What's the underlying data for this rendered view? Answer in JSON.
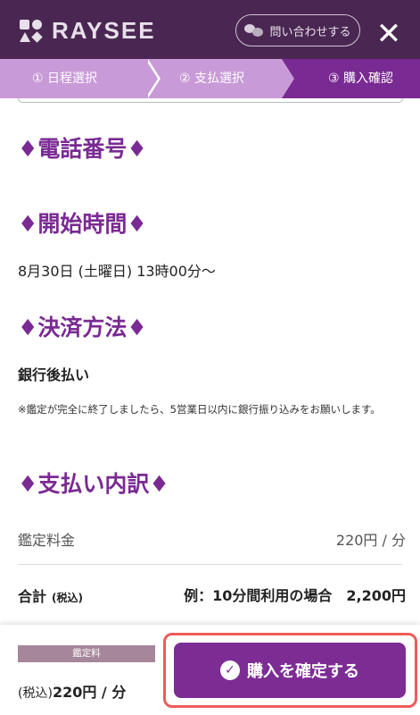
{
  "header": {
    "logo_text": "RAYSEE",
    "contact_label": "問い合わせする",
    "close_glyph": "✕"
  },
  "steps": [
    {
      "label": "① 日程選択"
    },
    {
      "label": "② 支払選択"
    },
    {
      "label": "③ 購入確認"
    }
  ],
  "sections": {
    "phone_title": "♦電話番号♦",
    "time_title": "♦開始時間♦",
    "datetime": "8月30日 (土曜日) 13時00分〜",
    "payment_title": "♦決済方法♦",
    "payment_method": "銀行後払い",
    "payment_note": "※鑑定が完全に終了しましたら、5営業日以内に銀行振り込みをお願いします。",
    "breakdown_title": "♦支払い内訳♦"
  },
  "breakdown": {
    "fee_label": "鑑定料金",
    "fee_value": "220円 / 分",
    "total_label": "合計",
    "total_tax": "(税込)",
    "total_example": "例：10分間利用の場合　2,200円"
  },
  "footer": {
    "badge": "鑑定料",
    "fee_prefix": "(税込)",
    "fee_amount": "220円 / 分",
    "confirm_label": "購入を確定する"
  },
  "colors": {
    "header_bg": "#4a2752",
    "step_bg": "#c99ad8",
    "step_active": "#7a2a93",
    "accent": "#7d2c94",
    "highlight": "#ef5b5b"
  }
}
